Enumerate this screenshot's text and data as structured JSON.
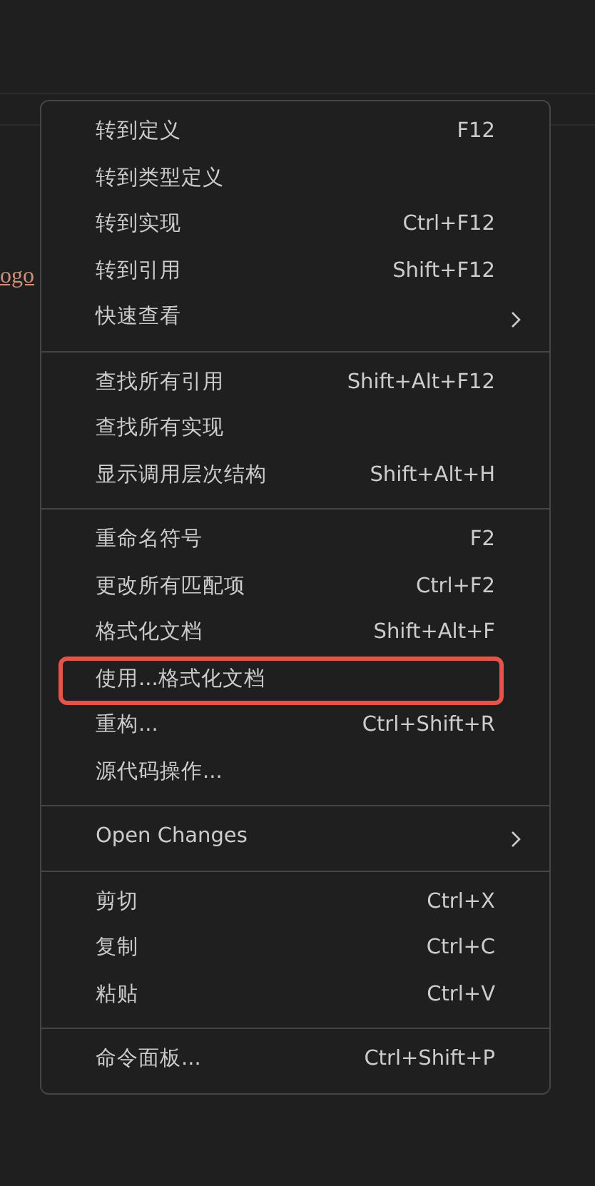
{
  "editor": {
    "link_text": "ogo"
  },
  "context_menu": {
    "groups": [
      {
        "items": [
          {
            "label": "转到定义",
            "shortcut": "F12",
            "submenu": false,
            "highlighted": false
          },
          {
            "label": "转到类型定义",
            "submenu": false,
            "highlighted": false
          },
          {
            "label": "转到实现",
            "shortcut": "Ctrl+F12",
            "submenu": false,
            "highlighted": false
          },
          {
            "label": "转到引用",
            "shortcut": "Shift+F12",
            "submenu": false,
            "highlighted": false
          },
          {
            "label": "快速查看",
            "submenu": true,
            "highlighted": false
          }
        ]
      },
      {
        "items": [
          {
            "label": "查找所有引用",
            "shortcut": "Shift+Alt+F12",
            "submenu": false,
            "highlighted": false
          },
          {
            "label": "查找所有实现",
            "submenu": false,
            "highlighted": false
          },
          {
            "label": "显示调用层次结构",
            "shortcut": "Shift+Alt+H",
            "submenu": false,
            "highlighted": false
          }
        ]
      },
      {
        "items": [
          {
            "label": "重命名符号",
            "shortcut": "F2",
            "submenu": false,
            "highlighted": false
          },
          {
            "label": "更改所有匹配项",
            "shortcut": "Ctrl+F2",
            "submenu": false,
            "highlighted": false
          },
          {
            "label": "格式化文档",
            "shortcut": "Shift+Alt+F",
            "submenu": false,
            "highlighted": false
          },
          {
            "label": "使用...格式化文档",
            "submenu": false,
            "highlighted": true
          },
          {
            "label": "重构...",
            "shortcut": "Ctrl+Shift+R",
            "submenu": false,
            "highlighted": false
          },
          {
            "label": "源代码操作...",
            "submenu": false,
            "highlighted": false
          }
        ]
      },
      {
        "items": [
          {
            "label": "Open Changes",
            "submenu": true,
            "highlighted": false
          }
        ]
      },
      {
        "items": [
          {
            "label": "剪切",
            "shortcut": "Ctrl+X",
            "submenu": false,
            "highlighted": false
          },
          {
            "label": "复制",
            "shortcut": "Ctrl+C",
            "submenu": false,
            "highlighted": false
          },
          {
            "label": "粘贴",
            "shortcut": "Ctrl+V",
            "submenu": false,
            "highlighted": false
          }
        ]
      },
      {
        "items": [
          {
            "label": "命令面板...",
            "shortcut": "Ctrl+Shift+P",
            "submenu": false,
            "highlighted": false
          }
        ]
      }
    ]
  }
}
